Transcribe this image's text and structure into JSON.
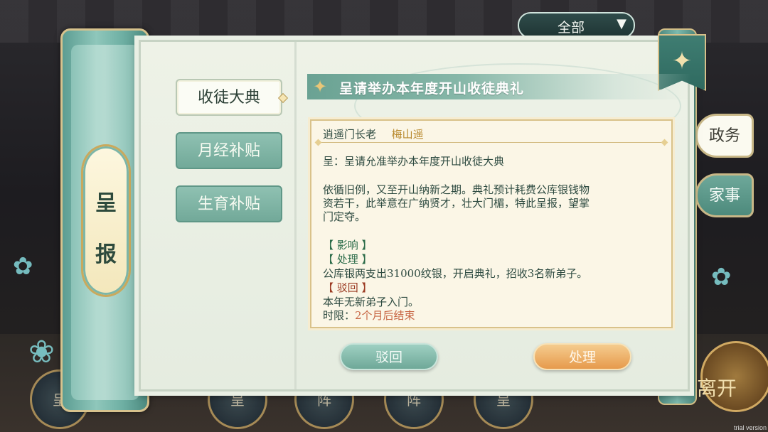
{
  "filter": {
    "selected": "全部"
  },
  "left_roller": {
    "label_chars": [
      "呈",
      "报"
    ]
  },
  "tabs": [
    {
      "label": "收徒大典",
      "active": true
    },
    {
      "label": "月经补贴",
      "active": false
    },
    {
      "label": "生育补贴",
      "active": false
    }
  ],
  "report": {
    "title": "呈请举办本年度开山收徒典礼",
    "author_role": "逍遥门长老",
    "author_name": "梅山遥",
    "subject": "呈：呈请允准举办本年度开山收徒大典",
    "body_lines": [
      "依循旧例，又至开山纳新之期。典礼预计耗费公库银钱物",
      "资若干，此举意在广纳贤才，壮大门楣，特此呈报，望掌",
      "门定夺。"
    ],
    "impact_header": "【 影响 】",
    "handle_header": "【 处理 】",
    "handle_text": "公库银两支出31000纹银，开启典礼，招收3名新弟子。",
    "reject_header": "【 驳回 】",
    "reject_text": "本年无新弟子入门。",
    "deadline_label": "时限：",
    "deadline_value": "2个月后结束"
  },
  "buttons": {
    "reject": "驳回",
    "handle": "处理"
  },
  "side_buttons": {
    "gov": "政务",
    "home": "家事"
  },
  "background": {
    "leave_text": "离开",
    "bottom_glyphs": [
      "呈",
      "呈",
      "阵",
      "阵",
      "呈"
    ]
  },
  "watermark": "trial version",
  "colors": {
    "accent_teal": "#6ea898",
    "accent_orange": "#e69a4c",
    "name_gold": "#b8892d",
    "deadline": "#c76543"
  }
}
